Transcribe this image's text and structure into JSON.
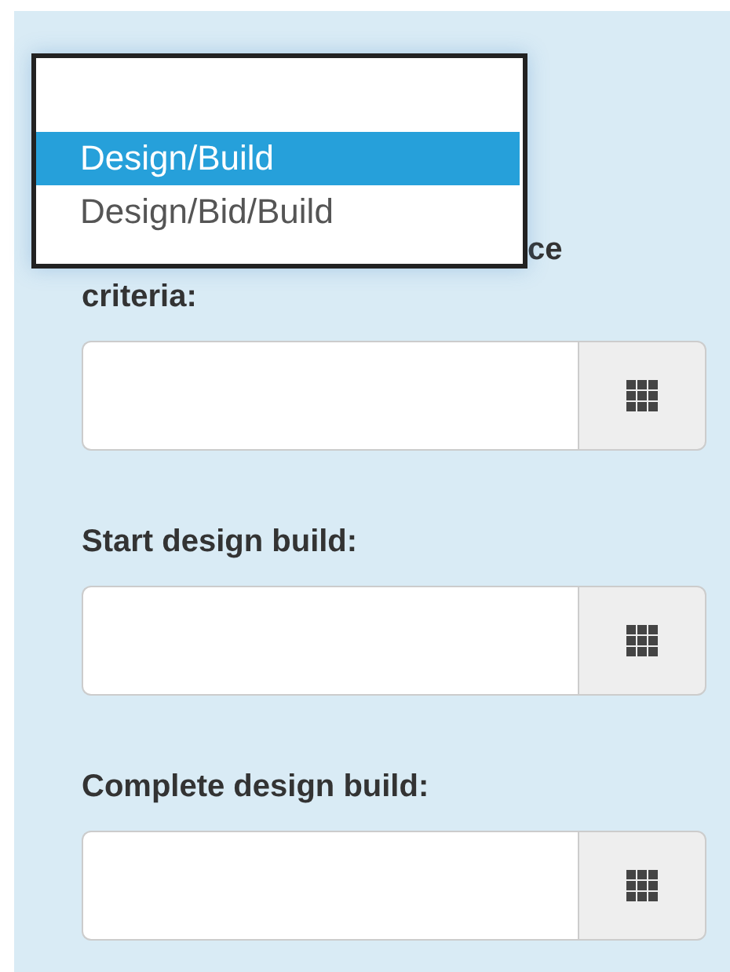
{
  "dropdown": {
    "options": [
      {
        "kind": "blank",
        "selected": false
      },
      {
        "kind": "option",
        "label": "Design/Build",
        "selected": true
      },
      {
        "kind": "option",
        "label": "Design/Bid/Build",
        "selected": false
      }
    ]
  },
  "fields": [
    {
      "label_fragment": "ce",
      "label": "criteria:"
    },
    {
      "label": "Start design build:"
    },
    {
      "label": "Complete design build:"
    }
  ]
}
